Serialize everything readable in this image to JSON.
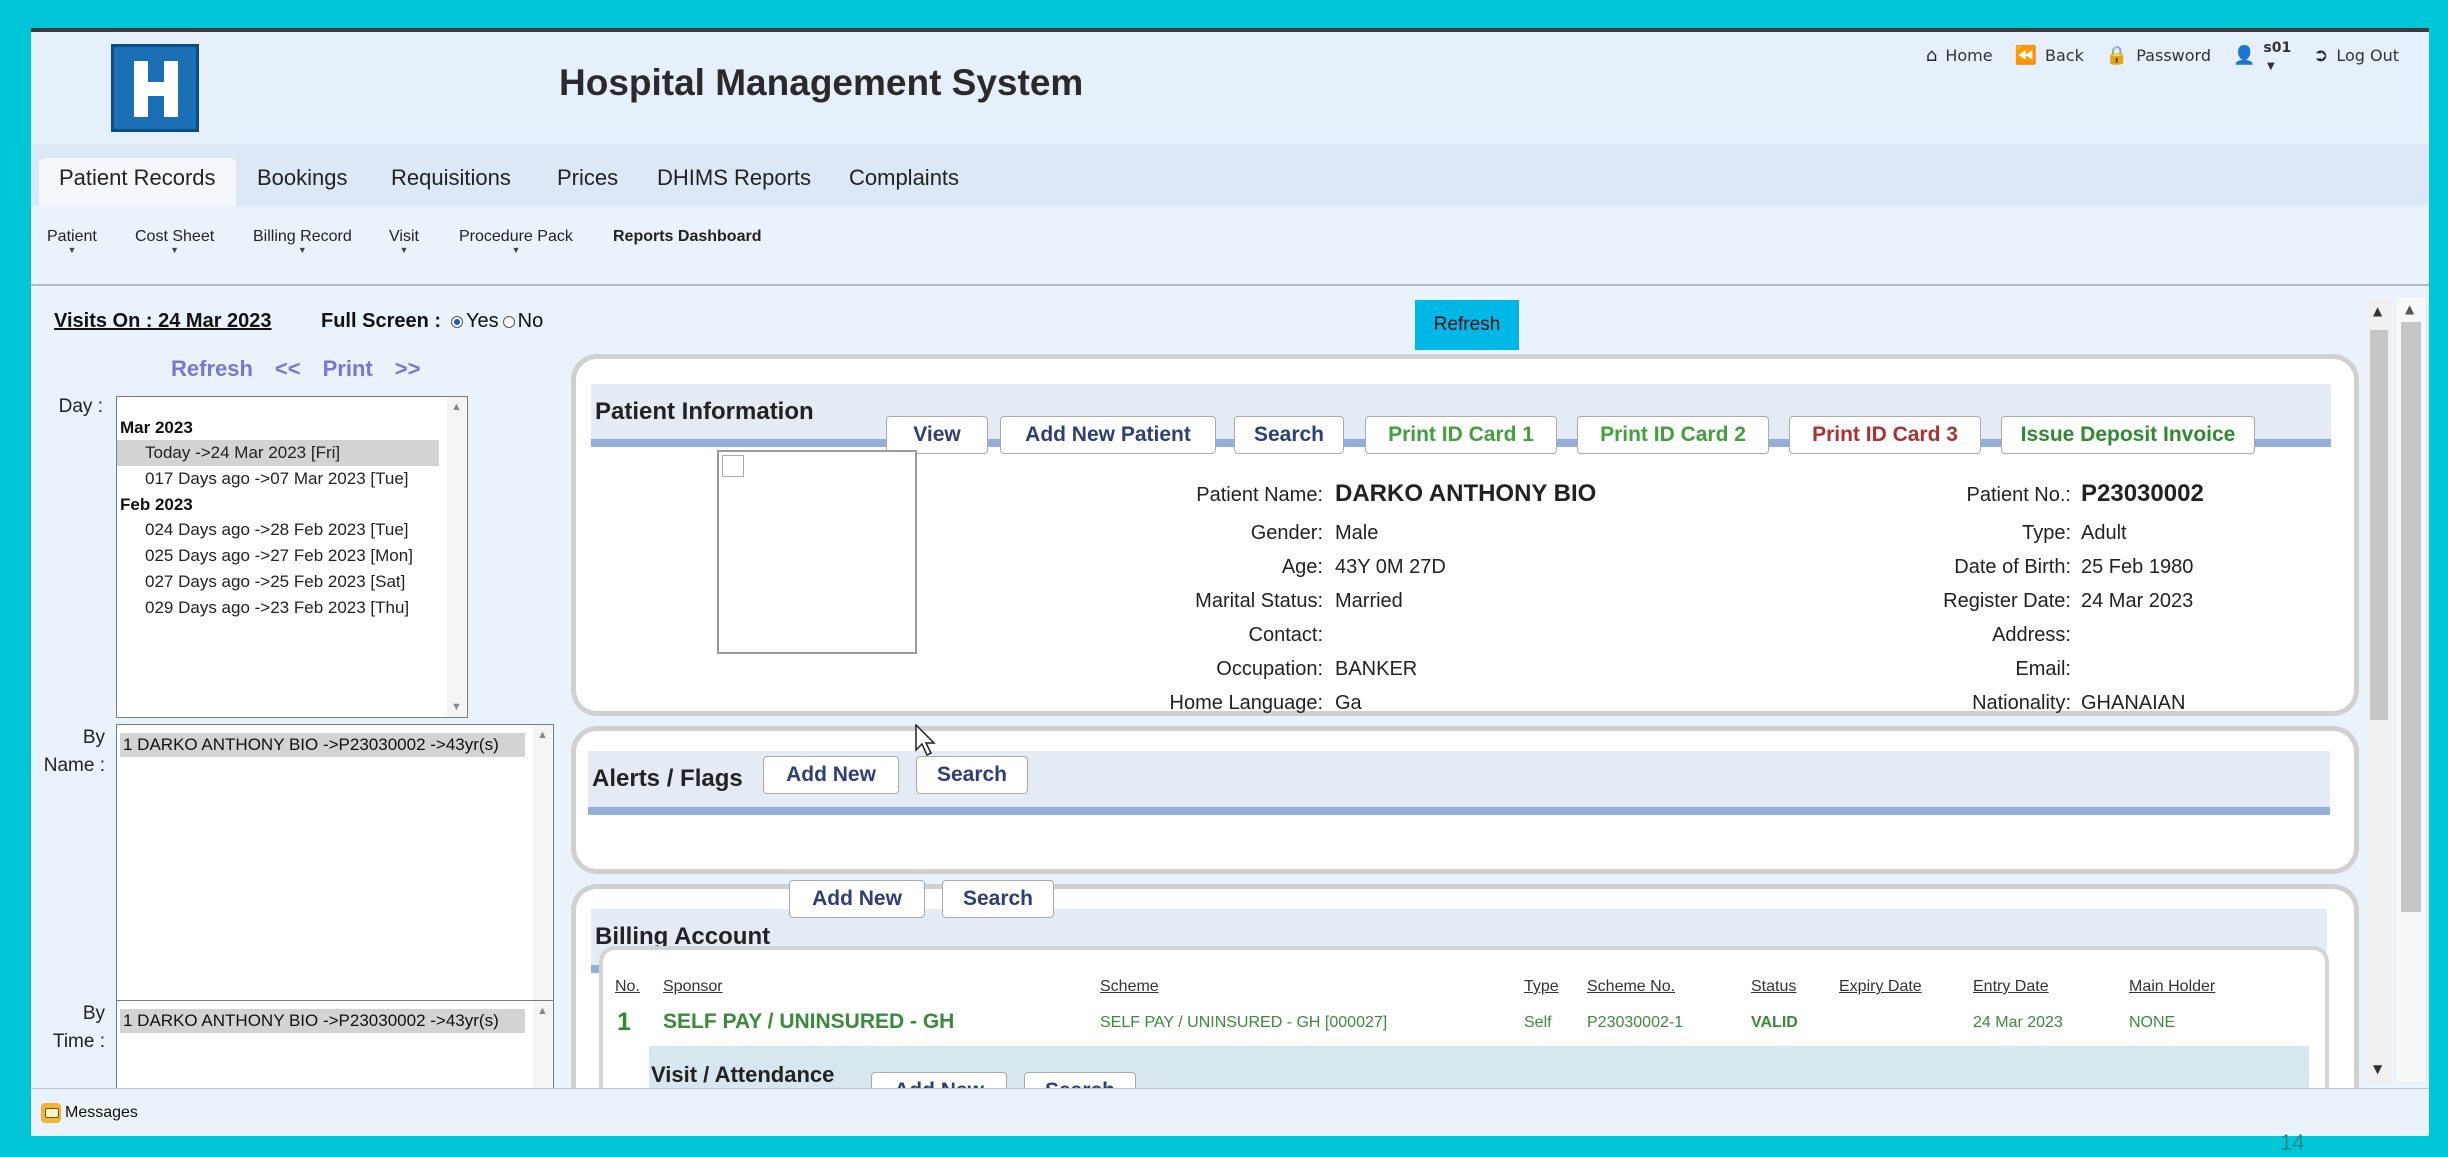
{
  "header": {
    "title": "Hospital Management System",
    "links": {
      "home": "Home",
      "back": "Back",
      "password": "Password",
      "user": "s01",
      "logout": "Log Out"
    }
  },
  "main_menu": [
    "Patient Records",
    "Bookings",
    "Requisitions",
    "Prices",
    "DHIMS Reports",
    "Complaints"
  ],
  "sub_menu": [
    "Patient",
    "Cost Sheet",
    "Billing Record",
    "Visit",
    "Procedure Pack",
    "Reports Dashboard"
  ],
  "left": {
    "visits_on": "Visits On :  24 Mar 2023",
    "full_screen_label": "Full Screen :",
    "yes": "Yes",
    "no": "No",
    "nav": {
      "refresh": "Refresh",
      "prev": "<<",
      "print": "Print",
      "next": ">>"
    },
    "day_label": "Day :",
    "day_list": {
      "groups": [
        {
          "label": "Mar 2023",
          "items": [
            "Today ->24 Mar 2023 [Fri]",
            "017 Days ago ->07 Mar 2023 [Tue]"
          ]
        },
        {
          "label": "Feb 2023",
          "items": [
            "024 Days ago ->28 Feb 2023 [Tue]",
            "025 Days ago ->27 Feb 2023 [Mon]",
            "027 Days ago ->25 Feb 2023 [Sat]",
            "029 Days ago ->23 Feb 2023 [Thu]"
          ]
        }
      ]
    },
    "by_name_label": [
      "By",
      "Name :"
    ],
    "by_name_item": "1  DARKO ANTHONY BIO ->P23030002 ->43yr(s)",
    "by_time_label": [
      "By",
      "Time :"
    ],
    "by_time_item": "1  DARKO ANTHONY BIO ->P23030002 ->43yr(s)"
  },
  "refresh_button": "Refresh",
  "patient_info": {
    "title": "Patient Information",
    "buttons": [
      "View",
      "Add New Patient",
      "Search",
      "Print ID Card 1",
      "Print ID Card 2",
      "Print ID Card 3",
      "Issue Deposit Invoice"
    ],
    "left_fields": [
      {
        "label": "Patient Name:",
        "value": "DARKO ANTHONY BIO"
      },
      {
        "label": "Gender:",
        "value": "Male"
      },
      {
        "label": "Age:",
        "value": "43Y 0M 27D"
      },
      {
        "label": "Marital Status:",
        "value": "Married"
      },
      {
        "label": "Contact:",
        "value": ""
      },
      {
        "label": "Occupation:",
        "value": "BANKER"
      },
      {
        "label": "Home Language:",
        "value": "Ga"
      }
    ],
    "right_fields": [
      {
        "label": "Patient No.:",
        "value": "P23030002"
      },
      {
        "label": "Type:",
        "value": "Adult"
      },
      {
        "label": "Date of Birth:",
        "value": "25 Feb 1980"
      },
      {
        "label": "Register Date:",
        "value": "24 Mar 2023"
      },
      {
        "label": "Address:",
        "value": ""
      },
      {
        "label": "Email:",
        "value": ""
      },
      {
        "label": "Nationality:",
        "value": "GHANAIAN"
      }
    ]
  },
  "alerts": {
    "title": "Alerts / Flags",
    "add_new": "Add New",
    "search": "Search"
  },
  "billing": {
    "title": "Billing Account",
    "add_new": "Add New",
    "search": "Search",
    "columns": [
      "No.",
      "Sponsor",
      "Scheme",
      "Type",
      "Scheme No.",
      "Status",
      "Expiry Date",
      "Entry Date",
      "Main Holder"
    ],
    "row": {
      "no": "1",
      "sponsor": "SELF PAY / UNINSURED - GH",
      "scheme": "SELF PAY / UNINSURED - GH [000027]",
      "type": "Self",
      "scheme_no": "P23030002-1",
      "status": "VALID",
      "expiry_date": "",
      "entry_date": "24 Mar 2023",
      "main_holder": "NONE"
    },
    "visit": {
      "title": "Visit / Attendance",
      "add_new": "Add New",
      "search": "Search"
    }
  },
  "footer": {
    "messages": "Messages"
  },
  "page_number": "14"
}
